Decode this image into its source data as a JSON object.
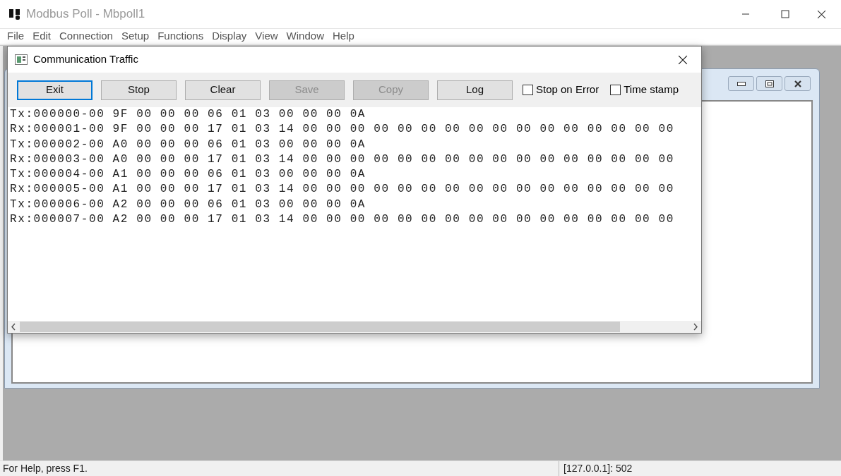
{
  "window": {
    "title": "Modbus Poll - Mbpoll1"
  },
  "menu": [
    "File",
    "Edit",
    "Connection",
    "Setup",
    "Functions",
    "Display",
    "View",
    "Window",
    "Help"
  ],
  "dialog": {
    "title": "Communication Traffic",
    "buttons": [
      {
        "label": "Exit",
        "disabled": false,
        "focused": true
      },
      {
        "label": "Stop",
        "disabled": false,
        "focused": false
      },
      {
        "label": "Clear",
        "disabled": false,
        "focused": false
      },
      {
        "label": "Save",
        "disabled": true,
        "focused": false
      },
      {
        "label": "Copy",
        "disabled": true,
        "focused": false
      },
      {
        "label": "Log",
        "disabled": false,
        "focused": false
      }
    ],
    "checkboxes": [
      {
        "label": "Stop on Error",
        "checked": false
      },
      {
        "label": "Time stamp",
        "checked": false
      }
    ],
    "lines": [
      "Tx:000000-00 9F 00 00 00 06 01 03 00 00 00 0A",
      "Rx:000001-00 9F 00 00 00 17 01 03 14 00 00 00 00 00 00 00 00 00 00 00 00 00 00 00 00",
      "Tx:000002-00 A0 00 00 00 06 01 03 00 00 00 0A",
      "Rx:000003-00 A0 00 00 00 17 01 03 14 00 00 00 00 00 00 00 00 00 00 00 00 00 00 00 00",
      "Tx:000004-00 A1 00 00 00 06 01 03 00 00 00 0A",
      "Rx:000005-00 A1 00 00 00 17 01 03 14 00 00 00 00 00 00 00 00 00 00 00 00 00 00 00 00",
      "Tx:000006-00 A2 00 00 00 06 01 03 00 00 00 0A",
      "Rx:000007-00 A2 00 00 00 17 01 03 14 00 00 00 00 00 00 00 00 00 00 00 00 00 00 00 00"
    ]
  },
  "status_bar": {
    "help": "For Help, press F1.",
    "connection": "[127.0.0.1]: 502"
  }
}
